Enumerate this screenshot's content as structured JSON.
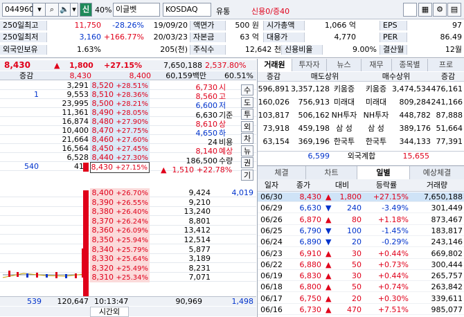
{
  "toolbar": {
    "code": "044960",
    "cat_btn": "신",
    "pct": "40%",
    "name": "이글벳",
    "market": "KOSDAQ",
    "sector": "유통",
    "credit": "신용0/증40"
  },
  "info": {
    "r1": {
      "l1": "250일최고",
      "v1": "11,750",
      "v2": "-28.26%",
      "v3": "19/09/20",
      "l2": "액면가",
      "v4": "500 원",
      "l3": "시가총액",
      "v5": "1,066 억",
      "l4": "EPS",
      "v6": "97"
    },
    "r2": {
      "l1": "250일최저",
      "v1": "3,160",
      "v2": "+166.77%",
      "v3": "20/03/23",
      "l2": "자본금",
      "v4": "63 억",
      "l3": "대용가",
      "v5": "4,770",
      "l4": "PER",
      "v6": "86.49"
    },
    "r3": {
      "l1": "외국인보유",
      "v1": "1.63%",
      "v4": "205(천)",
      "l2": "주식수",
      "v5": "12,642 천",
      "l3": "신용비율",
      "v6": "9.00%",
      "l4": "결산월",
      "v7": "12월"
    }
  },
  "quote": {
    "price": "8,430",
    "change": "1,800",
    "rate": "+27.15%",
    "volume": "7,650,188",
    "ratio": "2,537.80%",
    "amount": "60,159백만",
    "vr": "60.51%",
    "label_diff": "증감",
    "diff_a": "8,430",
    "diff_b": "8,400"
  },
  "asks": [
    {
      "q": "3,291",
      "p": "8,520",
      "r": "+28.51%"
    },
    {
      "c": "1",
      "q": "9,553",
      "p": "8,510",
      "r": "+28.36%"
    },
    {
      "q": "23,995",
      "p": "8,500",
      "r": "+28.21%"
    },
    {
      "q": "11,361",
      "p": "8,490",
      "r": "+28.05%"
    },
    {
      "q": "16,874",
      "p": "8,480",
      "r": "+27.90%"
    },
    {
      "q": "10,400",
      "p": "8,470",
      "r": "+27.75%"
    },
    {
      "q": "21,664",
      "p": "8,460",
      "r": "+27.60%"
    },
    {
      "q": "16,564",
      "p": "8,450",
      "r": "+27.45%"
    },
    {
      "q": "6,528",
      "p": "8,440",
      "r": "+27.30%"
    },
    {
      "c": "540",
      "q": "417",
      "p": "8,430",
      "r": "+27.15%"
    }
  ],
  "bids": [
    {
      "p": "8,400",
      "r": "+26.70%",
      "q": "9,424",
      "c": "4,019"
    },
    {
      "p": "8,390",
      "r": "+26.55%",
      "q": "9,210"
    },
    {
      "p": "8,380",
      "r": "+26.40%",
      "q": "13,240"
    },
    {
      "p": "8,370",
      "r": "+26.24%",
      "q": "8,801"
    },
    {
      "p": "8,360",
      "r": "+26.09%",
      "q": "13,412"
    },
    {
      "p": "8,350",
      "r": "+25.94%",
      "q": "12,514"
    },
    {
      "p": "8,340",
      "r": "+25.79%",
      "q": "5,877"
    },
    {
      "p": "8,330",
      "r": "+25.64%",
      "q": "3,189"
    },
    {
      "p": "8,320",
      "r": "+25.49%",
      "q": "8,231"
    },
    {
      "p": "8,310",
      "r": "+25.34%",
      "q": "7,071"
    }
  ],
  "ohlc": [
    {
      "v": "6,730",
      "l": "시"
    },
    {
      "v": "8,560",
      "l": "고"
    },
    {
      "v": "6,600",
      "l": "저"
    },
    {
      "v": "6,630",
      "l": "기준"
    },
    {
      "v": "8,610",
      "l": "상"
    },
    {
      "v": "4,650",
      "l": "하"
    },
    {
      "v": "24",
      "l": "비용"
    },
    {
      "v": "8,140",
      "l": "예상"
    },
    {
      "v": "186,500",
      "l": "수량"
    },
    {
      "v": "1,510",
      "l": "+22.78%"
    }
  ],
  "side_buttons": [
    "수",
    "도",
    "투",
    "외",
    "차",
    "뉴",
    "권",
    "기"
  ],
  "footer": {
    "ask_sum": "539",
    "total_ask": "120,647",
    "time": "10:13:47",
    "time_label": "시간외",
    "total_bid": "90,969",
    "bid_sum": "1,498"
  },
  "broker": {
    "tabs": [
      "거래원",
      "투자자",
      "뉴스",
      "재무",
      "종목별",
      "프로"
    ],
    "head": [
      "증감",
      "매도상위",
      "매수상위",
      "증감"
    ],
    "rows": [
      {
        "a": "596,891",
        "b": "3,357,128",
        "s": "키움증",
        "bb": "키움증",
        "c": "3,474,534",
        "d": "476,161"
      },
      {
        "a": "160,026",
        "b": "756,913",
        "s": "미래대",
        "bb": "미래대",
        "c": "809,284",
        "d": "241,166"
      },
      {
        "a": "103,817",
        "b": "506,162",
        "s": "NH투자",
        "bb": "NH투자",
        "c": "448,782",
        "d": "87,888"
      },
      {
        "a": "73,918",
        "b": "459,198",
        "s": "삼 성",
        "bb": "삼 성",
        "c": "389,176",
        "d": "51,664"
      },
      {
        "a": "63,154",
        "b": "369,196",
        "s": "한국투",
        "bb": "한국투",
        "c": "344,133",
        "d": "77,391"
      }
    ],
    "foreign": {
      "sell": "6,599",
      "label": "외국계합",
      "buy": "15,655"
    }
  },
  "daily": {
    "tabs": [
      "체결",
      "차트",
      "일별",
      "예상체결"
    ],
    "head": [
      "일자",
      "종가",
      "대비",
      "등락률",
      "거래량"
    ],
    "rows": [
      {
        "d": "06/30",
        "p": "8,430",
        "dir": "▲",
        "c": "1,800",
        "r": "+27.15%",
        "v": "7,650,188",
        "s": "up"
      },
      {
        "d": "06/29",
        "p": "6,630",
        "dir": "▼",
        "c": "240",
        "r": "-3.49%",
        "v": "301,449",
        "s": "dn"
      },
      {
        "d": "06/26",
        "p": "6,870",
        "dir": "▲",
        "c": "80",
        "r": "+1.18%",
        "v": "873,467",
        "s": "up"
      },
      {
        "d": "06/25",
        "p": "6,790",
        "dir": "▼",
        "c": "100",
        "r": "-1.45%",
        "v": "183,817",
        "s": "dn"
      },
      {
        "d": "06/24",
        "p": "6,890",
        "dir": "▼",
        "c": "20",
        "r": "-0.29%",
        "v": "243,146",
        "s": "dn"
      },
      {
        "d": "06/23",
        "p": "6,910",
        "dir": "▲",
        "c": "30",
        "r": "+0.44%",
        "v": "669,802",
        "s": "up"
      },
      {
        "d": "06/22",
        "p": "6,880",
        "dir": "▲",
        "c": "50",
        "r": "+0.73%",
        "v": "300,444",
        "s": "up"
      },
      {
        "d": "06/19",
        "p": "6,830",
        "dir": "▲",
        "c": "30",
        "r": "+0.44%",
        "v": "265,757",
        "s": "up"
      },
      {
        "d": "06/18",
        "p": "6,800",
        "dir": "▲",
        "c": "50",
        "r": "+0.74%",
        "v": "263,842",
        "s": "up"
      },
      {
        "d": "06/17",
        "p": "6,750",
        "dir": "▲",
        "c": "20",
        "r": "+0.30%",
        "v": "339,611",
        "s": "up"
      },
      {
        "d": "06/16",
        "p": "6,730",
        "dir": "▲",
        "c": "470",
        "r": "+7.51%",
        "v": "985,077",
        "s": "up"
      }
    ]
  }
}
